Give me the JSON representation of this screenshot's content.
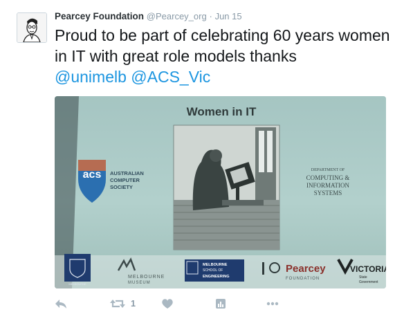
{
  "tweet": {
    "author_name": "Pearcey Foundation",
    "author_handle": "@Pearcey_org",
    "separator": "·",
    "date": "Jun 15",
    "text_main": "Proud to be part of celebrating 60 years women in IT with great role models thanks",
    "mention_1": "@unimelb",
    "mention_2": "@ACS_Vic"
  },
  "photo": {
    "slide_title": "Women in IT",
    "acs_logo_text": "acs",
    "acs_line1": "AUSTRALIAN",
    "acs_line2": "COMPUTER",
    "acs_line3": "SOCIETY",
    "dept_line1": "DEPARTMENT OF",
    "dept_line2": "COMPUTING &",
    "dept_line3": "INFORMATION",
    "dept_line4": "SYSTEMS",
    "museum_line1": "MELBOURNE",
    "museum_line2": "MUSEUM",
    "unimelb_small": "MELBOURNE",
    "eng_line1": "MELBOURNE",
    "eng_line2": "SCHOOL OF",
    "eng_line3": "ENGINEERING",
    "pearcey_name": "Pearcey",
    "pearcey_sub": "FOUNDATION",
    "vic_name": "VICTORIA",
    "vic_sub1": "State",
    "vic_sub2": "Government"
  },
  "actions": {
    "retweet_count": "1"
  },
  "colors": {
    "accent": "#1b95e0",
    "icon": "#aab8c2",
    "photo_bg": "#a8c6c2"
  }
}
